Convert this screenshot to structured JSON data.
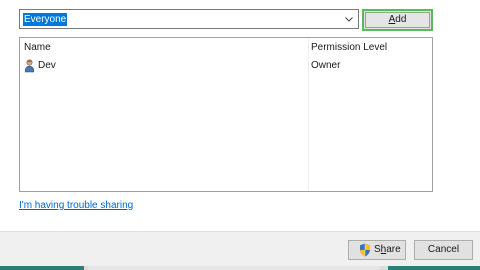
{
  "combo": {
    "value": "Everyone",
    "arrow_icon": "chevron-down-icon"
  },
  "add_button": {
    "label_before": "",
    "mnemonic": "A",
    "label_after": "dd"
  },
  "list": {
    "columns": [
      "Name",
      "Permission Level"
    ],
    "rows": [
      {
        "name": "Dev",
        "permission": "Owner",
        "icon": "user-icon"
      }
    ]
  },
  "trouble_link": "I'm having trouble sharing",
  "footer": {
    "share_before": "S",
    "share_mnemonic": "h",
    "share_after": "are",
    "share_icon": "uac-shield-icon",
    "cancel_label": "Cancel"
  },
  "colors": {
    "selection": "#0078d7",
    "focus_border": "#5cb85c",
    "link": "#0066cc",
    "taskbar_accent": "#2c7e79"
  }
}
